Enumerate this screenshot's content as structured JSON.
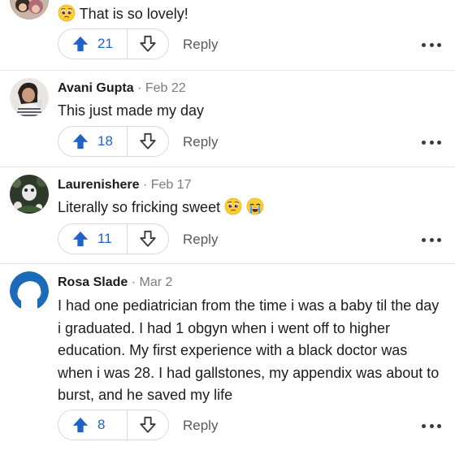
{
  "comments": [
    {
      "author": "",
      "date": "",
      "text": "That is so lovely!",
      "emoji_prefix": [
        "pleading-face-icon"
      ],
      "upvotes": "21",
      "reply_label": "Reply"
    },
    {
      "author": "Avani Gupta",
      "separator": "·",
      "date": "Feb 22",
      "text": "This just made my day",
      "upvotes": "18",
      "reply_label": "Reply"
    },
    {
      "author": "Laurenishere",
      "separator": "·",
      "date": "Feb 17",
      "text": "Literally so fricking sweet",
      "emoji_suffix": [
        "pleading-face-icon",
        "crying-face-icon"
      ],
      "upvotes": "11",
      "reply_label": "Reply"
    },
    {
      "author": "Rosa Slade",
      "separator": "·",
      "date": "Mar 2",
      "text": "I had one pediatrician from the time i was a baby til the day i graduated. I had 1 obgyn when i went off to higher education. My first experience with a black doctor was when i was 28. I had gallstones, my appendix was about to burst, and he saved my life",
      "upvotes": "8",
      "reply_label": "Reply"
    }
  ],
  "colors": {
    "upvote_blue": "#1f63c7",
    "default_avatar_blue": "#1c6bb8",
    "divider": "#e4e6eb"
  }
}
